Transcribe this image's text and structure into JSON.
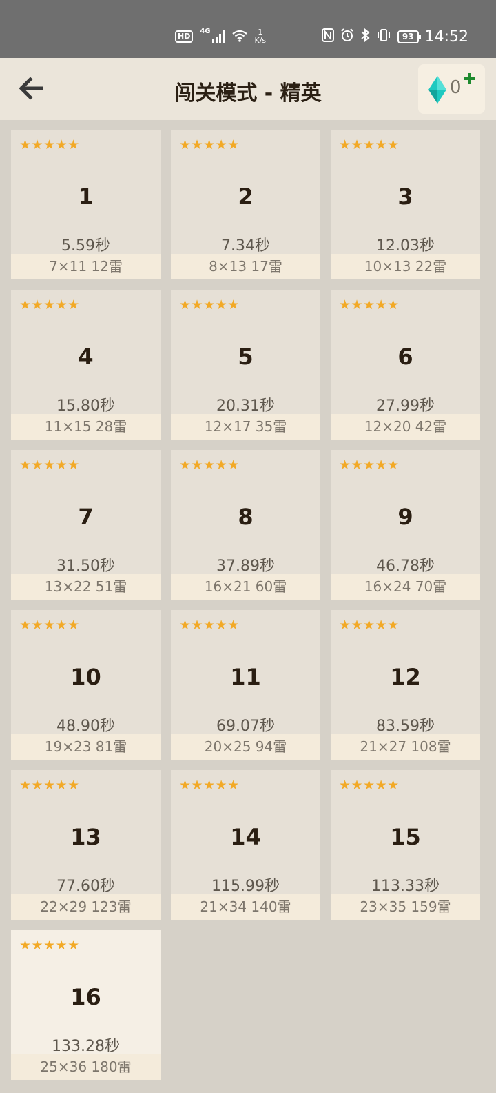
{
  "status": {
    "hd": "HD",
    "net_type": "4G",
    "net_speed_value": "1",
    "net_speed_unit": "K/s",
    "battery": "93",
    "time": "14:52"
  },
  "header": {
    "title": "闯关模式 - 精英",
    "gem_count": "0"
  },
  "levels": [
    {
      "num": "1",
      "stars": "★★★★★",
      "time": "5.59秒",
      "info": "7×11  12雷"
    },
    {
      "num": "2",
      "stars": "★★★★★",
      "time": "7.34秒",
      "info": "8×13  17雷"
    },
    {
      "num": "3",
      "stars": "★★★★★",
      "time": "12.03秒",
      "info": "10×13  22雷"
    },
    {
      "num": "4",
      "stars": "★★★★★",
      "time": "15.80秒",
      "info": "11×15  28雷"
    },
    {
      "num": "5",
      "stars": "★★★★★",
      "time": "20.31秒",
      "info": "12×17  35雷"
    },
    {
      "num": "6",
      "stars": "★★★★★",
      "time": "27.99秒",
      "info": "12×20  42雷"
    },
    {
      "num": "7",
      "stars": "★★★★★",
      "time": "31.50秒",
      "info": "13×22  51雷"
    },
    {
      "num": "8",
      "stars": "★★★★★",
      "time": "37.89秒",
      "info": "16×21  60雷"
    },
    {
      "num": "9",
      "stars": "★★★★★",
      "time": "46.78秒",
      "info": "16×24  70雷"
    },
    {
      "num": "10",
      "stars": "★★★★★",
      "time": "48.90秒",
      "info": "19×23  81雷"
    },
    {
      "num": "11",
      "stars": "★★★★★",
      "time": "69.07秒",
      "info": "20×25  94雷"
    },
    {
      "num": "12",
      "stars": "★★★★★",
      "time": "83.59秒",
      "info": "21×27  108雷"
    },
    {
      "num": "13",
      "stars": "★★★★★",
      "time": "77.60秒",
      "info": "22×29  123雷"
    },
    {
      "num": "14",
      "stars": "★★★★★",
      "time": "115.99秒",
      "info": "21×34  140雷"
    },
    {
      "num": "15",
      "stars": "★★★★★",
      "time": "113.33秒",
      "info": "23×35  159雷"
    },
    {
      "num": "16",
      "stars": "★★★★★",
      "time": "133.28秒",
      "info": "25×36  180雷"
    }
  ],
  "colors": {
    "star": "#f2a926",
    "gem": "#1fc9c0",
    "plus": "#1e8a2e",
    "card": "#e6e0d6",
    "card_selected": "#f5efe5"
  },
  "icons": {
    "back": "back-arrow-icon",
    "gem": "diamond-gem-icon",
    "plus": "plus-icon",
    "star": "star-icon"
  }
}
